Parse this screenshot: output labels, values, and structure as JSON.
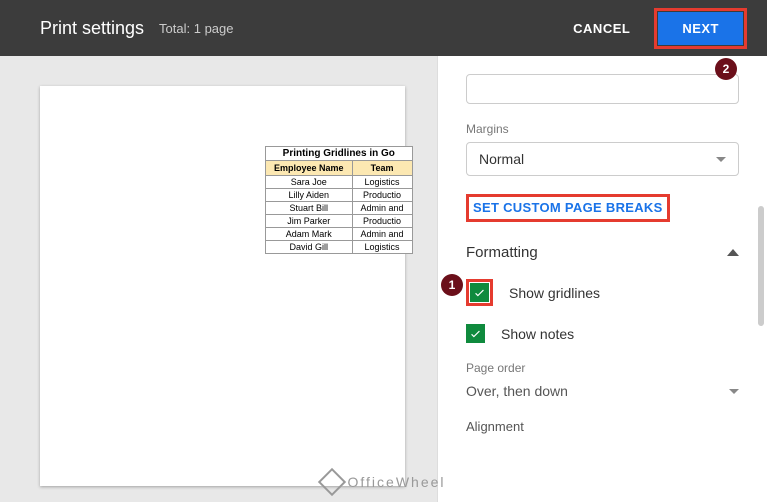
{
  "header": {
    "title": "Print settings",
    "subtotal": "Total: 1 page",
    "cancel": "CANCEL",
    "next": "NEXT"
  },
  "badges": {
    "one": "1",
    "two": "2"
  },
  "preview": {
    "title": "Printing Gridlines in Go",
    "headers": {
      "name": "Employee Name",
      "team": "Team"
    },
    "rows": [
      {
        "name": "Sara Joe",
        "team": "Logistics"
      },
      {
        "name": "Lilly Aiden",
        "team": "Productio"
      },
      {
        "name": "Stuart Bill",
        "team": "Admin and"
      },
      {
        "name": "Jim Parker",
        "team": "Productio"
      },
      {
        "name": "Adam Mark",
        "team": "Admin and"
      },
      {
        "name": "David Gill",
        "team": "Logistics"
      }
    ]
  },
  "panel": {
    "margins_label": "Margins",
    "margins_value": "Normal",
    "custom_breaks": "SET CUSTOM PAGE BREAKS",
    "formatting": "Formatting",
    "show_gridlines": "Show gridlines",
    "show_notes": "Show notes",
    "page_order_label": "Page order",
    "page_order_value": "Over, then down",
    "alignment": "Alignment"
  },
  "watermark": "OfficeWheel"
}
